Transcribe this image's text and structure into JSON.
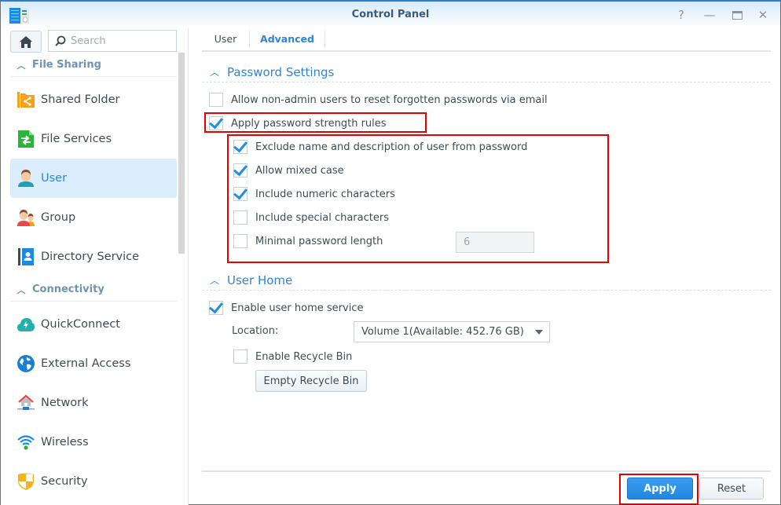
{
  "window": {
    "title": "Control Panel",
    "controls": {
      "help": "?",
      "minimize": "—",
      "maximize": "□",
      "close": "✕"
    }
  },
  "sidebar": {
    "search_placeholder": "Search",
    "sections": [
      {
        "label": "File Sharing",
        "items": [
          {
            "label": "Shared Folder",
            "icon": "shared-folder-icon",
            "active": false
          },
          {
            "label": "File Services",
            "icon": "file-services-icon",
            "active": false
          },
          {
            "label": "User",
            "icon": "user-icon",
            "active": true
          },
          {
            "label": "Group",
            "icon": "group-icon",
            "active": false
          },
          {
            "label": "Directory Service",
            "icon": "directory-service-icon",
            "active": false
          }
        ]
      },
      {
        "label": "Connectivity",
        "items": [
          {
            "label": "QuickConnect",
            "icon": "quickconnect-icon",
            "active": false
          },
          {
            "label": "External Access",
            "icon": "globe-icon",
            "active": false
          },
          {
            "label": "Network",
            "icon": "network-icon",
            "active": false
          },
          {
            "label": "Wireless",
            "icon": "wifi-icon",
            "active": false
          },
          {
            "label": "Security",
            "icon": "shield-icon",
            "active": false
          }
        ]
      }
    ]
  },
  "main": {
    "tabs": [
      {
        "label": "User",
        "active": false
      },
      {
        "label": "Advanced",
        "active": true
      }
    ],
    "password_settings": {
      "title": "Password Settings",
      "allow_reset": {
        "label": "Allow non-admin users to reset forgotten passwords via email",
        "checked": false
      },
      "apply_rules": {
        "label": "Apply password strength rules",
        "checked": true
      },
      "rules": [
        {
          "label": "Exclude name and description of user from password",
          "checked": true
        },
        {
          "label": "Allow mixed case",
          "checked": true
        },
        {
          "label": "Include numeric characters",
          "checked": true
        },
        {
          "label": "Include special characters",
          "checked": false
        },
        {
          "label": "Minimal password length",
          "checked": false
        }
      ],
      "min_length_value": "6"
    },
    "user_home": {
      "title": "User Home",
      "enable_service": {
        "label": "Enable user home service",
        "checked": true
      },
      "location_label": "Location:",
      "location_value": "Volume 1(Available: 452.76 GB)",
      "enable_recycle": {
        "label": "Enable Recycle Bin",
        "checked": false
      },
      "empty_recycle_label": "Empty Recycle Bin"
    },
    "footer": {
      "apply_label": "Apply",
      "reset_label": "Reset"
    }
  },
  "colors": {
    "accent": "#2f84d6",
    "highlight": "#e60000",
    "active_nav_bg": "#dbecfc"
  }
}
